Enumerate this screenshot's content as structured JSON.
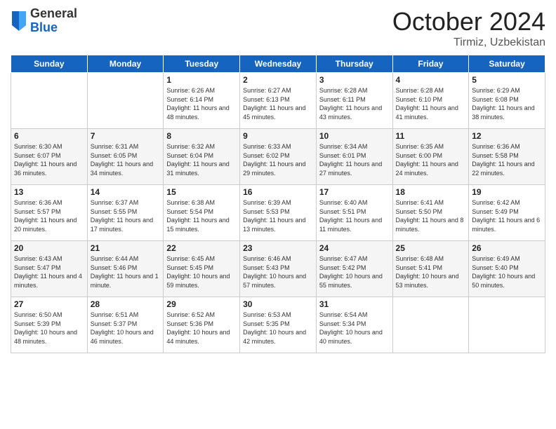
{
  "header": {
    "logo": {
      "general": "General",
      "blue": "Blue"
    },
    "title": "October 2024",
    "subtitle": "Tirmiz, Uzbekistan"
  },
  "days_of_week": [
    "Sunday",
    "Monday",
    "Tuesday",
    "Wednesday",
    "Thursday",
    "Friday",
    "Saturday"
  ],
  "weeks": [
    [
      {
        "day": "",
        "info": ""
      },
      {
        "day": "",
        "info": ""
      },
      {
        "day": "1",
        "info": "Sunrise: 6:26 AM\nSunset: 6:14 PM\nDaylight: 11 hours and 48 minutes."
      },
      {
        "day": "2",
        "info": "Sunrise: 6:27 AM\nSunset: 6:13 PM\nDaylight: 11 hours and 45 minutes."
      },
      {
        "day": "3",
        "info": "Sunrise: 6:28 AM\nSunset: 6:11 PM\nDaylight: 11 hours and 43 minutes."
      },
      {
        "day": "4",
        "info": "Sunrise: 6:28 AM\nSunset: 6:10 PM\nDaylight: 11 hours and 41 minutes."
      },
      {
        "day": "5",
        "info": "Sunrise: 6:29 AM\nSunset: 6:08 PM\nDaylight: 11 hours and 38 minutes."
      }
    ],
    [
      {
        "day": "6",
        "info": "Sunrise: 6:30 AM\nSunset: 6:07 PM\nDaylight: 11 hours and 36 minutes."
      },
      {
        "day": "7",
        "info": "Sunrise: 6:31 AM\nSunset: 6:05 PM\nDaylight: 11 hours and 34 minutes."
      },
      {
        "day": "8",
        "info": "Sunrise: 6:32 AM\nSunset: 6:04 PM\nDaylight: 11 hours and 31 minutes."
      },
      {
        "day": "9",
        "info": "Sunrise: 6:33 AM\nSunset: 6:02 PM\nDaylight: 11 hours and 29 minutes."
      },
      {
        "day": "10",
        "info": "Sunrise: 6:34 AM\nSunset: 6:01 PM\nDaylight: 11 hours and 27 minutes."
      },
      {
        "day": "11",
        "info": "Sunrise: 6:35 AM\nSunset: 6:00 PM\nDaylight: 11 hours and 24 minutes."
      },
      {
        "day": "12",
        "info": "Sunrise: 6:36 AM\nSunset: 5:58 PM\nDaylight: 11 hours and 22 minutes."
      }
    ],
    [
      {
        "day": "13",
        "info": "Sunrise: 6:36 AM\nSunset: 5:57 PM\nDaylight: 11 hours and 20 minutes."
      },
      {
        "day": "14",
        "info": "Sunrise: 6:37 AM\nSunset: 5:55 PM\nDaylight: 11 hours and 17 minutes."
      },
      {
        "day": "15",
        "info": "Sunrise: 6:38 AM\nSunset: 5:54 PM\nDaylight: 11 hours and 15 minutes."
      },
      {
        "day": "16",
        "info": "Sunrise: 6:39 AM\nSunset: 5:53 PM\nDaylight: 11 hours and 13 minutes."
      },
      {
        "day": "17",
        "info": "Sunrise: 6:40 AM\nSunset: 5:51 PM\nDaylight: 11 hours and 11 minutes."
      },
      {
        "day": "18",
        "info": "Sunrise: 6:41 AM\nSunset: 5:50 PM\nDaylight: 11 hours and 8 minutes."
      },
      {
        "day": "19",
        "info": "Sunrise: 6:42 AM\nSunset: 5:49 PM\nDaylight: 11 hours and 6 minutes."
      }
    ],
    [
      {
        "day": "20",
        "info": "Sunrise: 6:43 AM\nSunset: 5:47 PM\nDaylight: 11 hours and 4 minutes."
      },
      {
        "day": "21",
        "info": "Sunrise: 6:44 AM\nSunset: 5:46 PM\nDaylight: 11 hours and 1 minute."
      },
      {
        "day": "22",
        "info": "Sunrise: 6:45 AM\nSunset: 5:45 PM\nDaylight: 10 hours and 59 minutes."
      },
      {
        "day": "23",
        "info": "Sunrise: 6:46 AM\nSunset: 5:43 PM\nDaylight: 10 hours and 57 minutes."
      },
      {
        "day": "24",
        "info": "Sunrise: 6:47 AM\nSunset: 5:42 PM\nDaylight: 10 hours and 55 minutes."
      },
      {
        "day": "25",
        "info": "Sunrise: 6:48 AM\nSunset: 5:41 PM\nDaylight: 10 hours and 53 minutes."
      },
      {
        "day": "26",
        "info": "Sunrise: 6:49 AM\nSunset: 5:40 PM\nDaylight: 10 hours and 50 minutes."
      }
    ],
    [
      {
        "day": "27",
        "info": "Sunrise: 6:50 AM\nSunset: 5:39 PM\nDaylight: 10 hours and 48 minutes."
      },
      {
        "day": "28",
        "info": "Sunrise: 6:51 AM\nSunset: 5:37 PM\nDaylight: 10 hours and 46 minutes."
      },
      {
        "day": "29",
        "info": "Sunrise: 6:52 AM\nSunset: 5:36 PM\nDaylight: 10 hours and 44 minutes."
      },
      {
        "day": "30",
        "info": "Sunrise: 6:53 AM\nSunset: 5:35 PM\nDaylight: 10 hours and 42 minutes."
      },
      {
        "day": "31",
        "info": "Sunrise: 6:54 AM\nSunset: 5:34 PM\nDaylight: 10 hours and 40 minutes."
      },
      {
        "day": "",
        "info": ""
      },
      {
        "day": "",
        "info": ""
      }
    ]
  ]
}
